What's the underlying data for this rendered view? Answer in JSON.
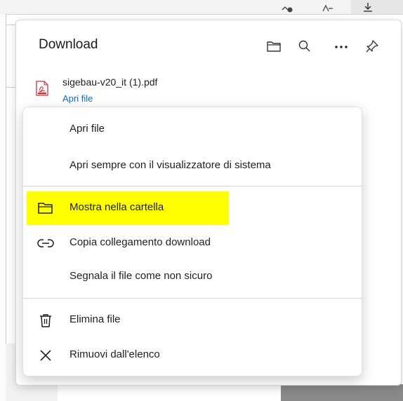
{
  "panel": {
    "title": "Download",
    "actions": [
      {
        "icon": "folder-icon"
      },
      {
        "icon": "search-icon"
      },
      {
        "icon": "more-icon",
        "label": "···"
      },
      {
        "icon": "pin-icon"
      }
    ]
  },
  "download": {
    "file_name": "sigebau-v20_it (1).pdf",
    "open_link": "Apri file",
    "icon": "pdf-icon"
  },
  "menu": {
    "items": [
      {
        "label": "Apri file",
        "icon": null
      },
      {
        "label": "Apri sempre con il visualizzatore di sistema",
        "icon": null
      },
      {
        "label": "Mostra nella cartella",
        "icon": "folder-icon",
        "highlighted": true
      },
      {
        "label": "Copia collegamento download",
        "icon": "link-icon"
      },
      {
        "label": "Segnala il file come non sicuro",
        "icon": null
      },
      {
        "label": "Elimina file",
        "icon": "trash-icon"
      },
      {
        "label": "Rimuovi dall'elenco",
        "icon": "close-icon"
      }
    ]
  },
  "colors": {
    "highlight": "#ffff00",
    "link": "#0f6cbd",
    "pdf_red": "#d13438"
  }
}
